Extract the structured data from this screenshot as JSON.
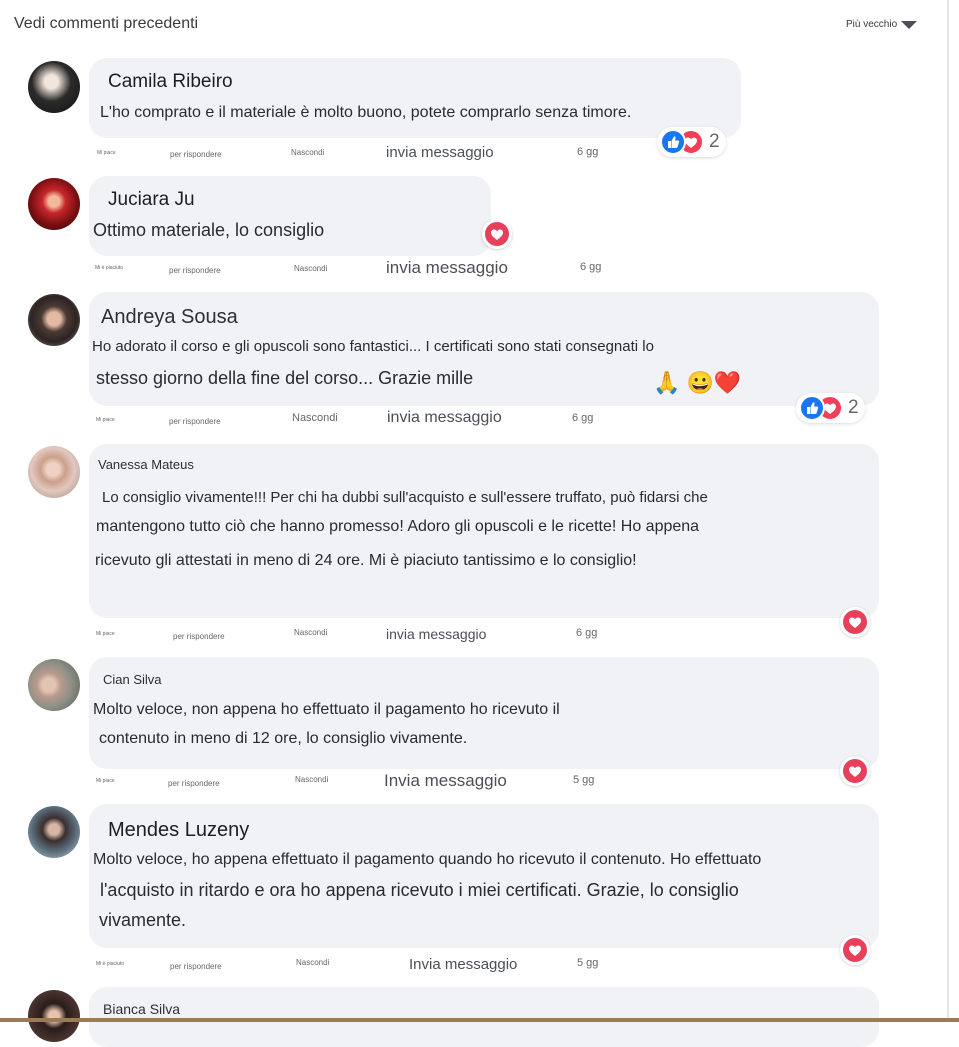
{
  "header": {
    "view_previous": "Vedi commenti precedenti",
    "sort_label": "Più vecchio"
  },
  "actions": {
    "like": "Mi piace",
    "liked": "Mi è piaciuto",
    "reply": "per rispondere",
    "hide": "Nascondi"
  },
  "comments": [
    {
      "author": "Camila Ribeiro",
      "lines": [
        "L'ho comprato e il materiale è molto buono, potete comprarlo senza timore."
      ],
      "send": "invia messaggio",
      "time": "6 gg",
      "reaction_count": "2"
    },
    {
      "author": "Juciara Ju",
      "lines": [
        "Ottimo materiale, lo consiglio"
      ],
      "send": "invia messaggio",
      "time": "6 gg"
    },
    {
      "author": "Andreya Sousa",
      "lines": [
        "Ho adorato il corso e gli opuscoli sono fantastici... I certificati sono stati consegnati lo",
        "stesso giorno della fine del corso... Grazie mille"
      ],
      "emojis": "🙏 😀❤️",
      "send": "invia messaggio",
      "time": "6 gg",
      "reaction_count": "2"
    },
    {
      "author": "Vanessa Mateus",
      "lines": [
        "Lo consiglio vivamente!!! Per chi ha dubbi sull'acquisto e sull'essere truffato, può fidarsi che",
        "mantengono tutto ciò che hanno promesso! Adoro gli opuscoli e le ricette! Ho appena",
        "ricevuto gli attestati in meno di 24 ore. Mi è piaciuto tantissimo e lo consiglio!"
      ],
      "send": "invia messaggio",
      "time": "6 gg"
    },
    {
      "author": "Cian Silva",
      "lines": [
        "Molto veloce, non appena ho effettuato il pagamento ho ricevuto il",
        "contenuto in meno di 12 ore, lo consiglio vivamente."
      ],
      "send": "Invia messaggio",
      "time": "5 gg"
    },
    {
      "author": "Mendes Luzeny",
      "lines": [
        "Molto veloce, ho appena effettuato il pagamento quando ho ricevuto il contenuto. Ho effettuato",
        "l'acquisto in ritardo e ora ho appena ricevuto i miei certificati. Grazie, lo consiglio",
        "vivamente."
      ],
      "send": "Invia messaggio",
      "time": "5 gg"
    },
    {
      "author": "Bianca Silva"
    }
  ],
  "colors": {
    "bubble": "#f0f2f5",
    "like_blue": "#1877f2",
    "love_red": "#f33e58"
  },
  "icons": {
    "like": "thumbs-up-icon",
    "love": "heart-icon",
    "sort": "caret-down-icon"
  }
}
